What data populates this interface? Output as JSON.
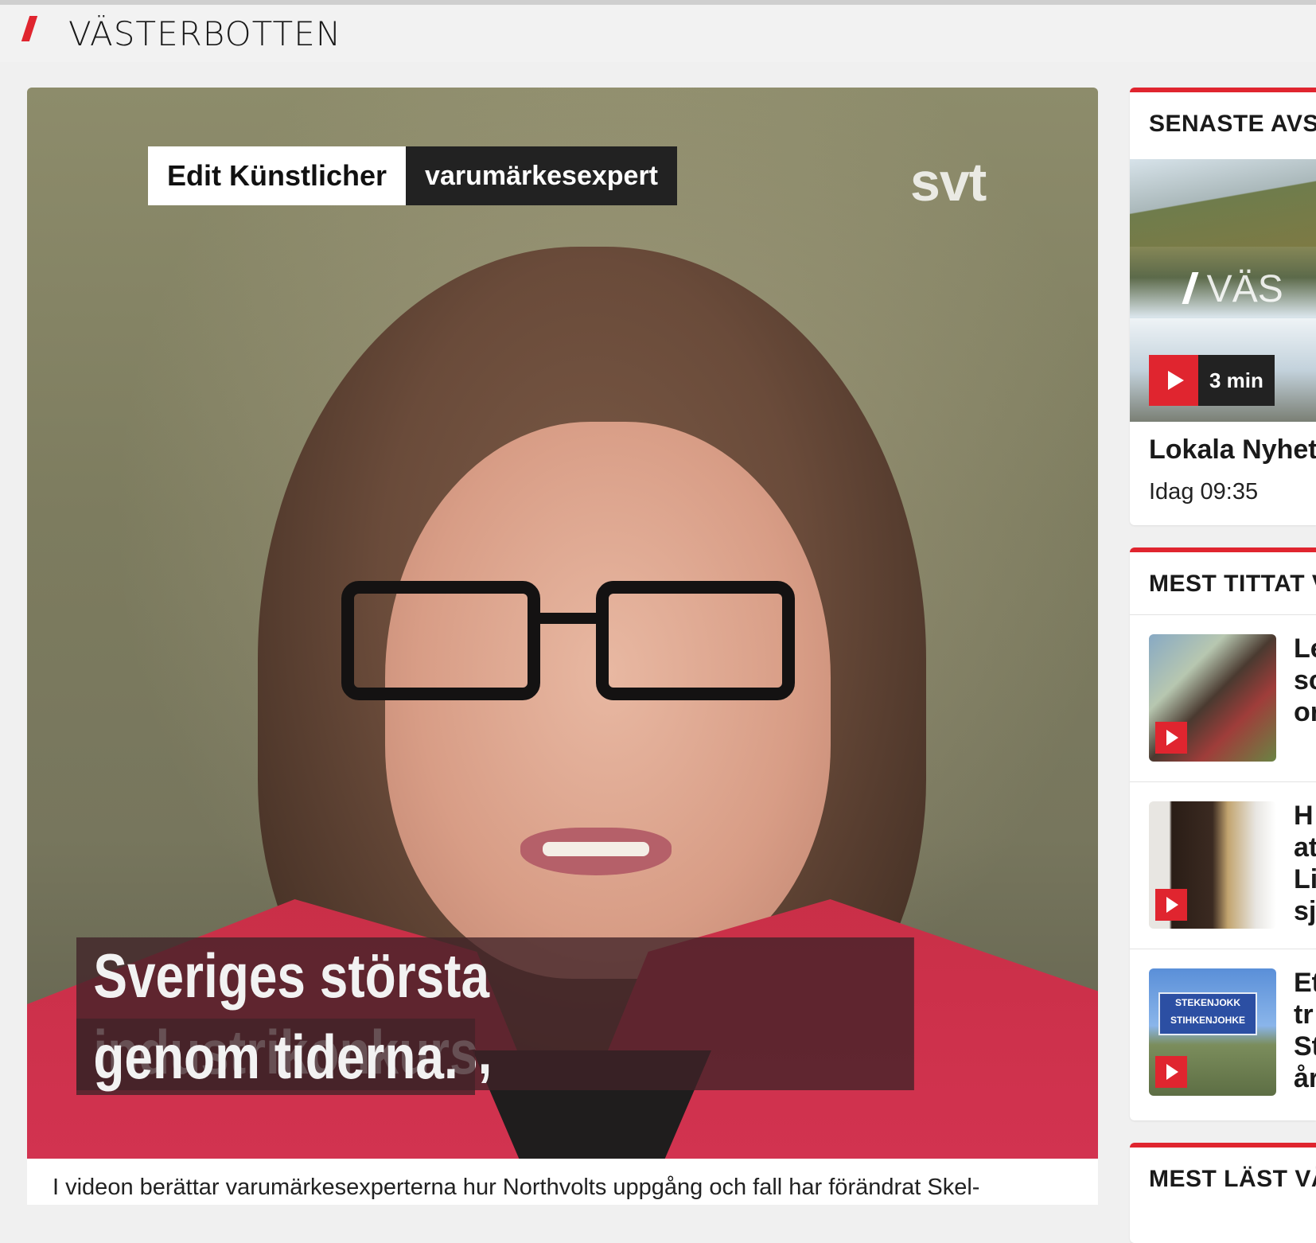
{
  "header": {
    "section_title": "VÄSTERBOTTEN"
  },
  "video": {
    "person_name": "Edit Künstlicher",
    "person_role": "varumärkesexpert",
    "brand_logo": "svt",
    "subtitle_line1": "Sveriges största industrikonkurs,",
    "subtitle_line2": "genom tiderna."
  },
  "caption": {
    "text": "I videon berättar varumärkesexperterna hur Northvolts uppgång och fall har förändrat Skel-"
  },
  "sidebar": {
    "latest": {
      "heading": "SENASTE AVS",
      "thumb_watermark": "VÄS",
      "duration": "3 min",
      "title": "Lokala Nyhet",
      "time": "Idag 09:35"
    },
    "most_watched": {
      "heading": "MEST TITTAT V",
      "items": [
        {
          "text": "Le\nsc\nor"
        },
        {
          "text": "H\nat\nLi\nsj"
        },
        {
          "text": "Et\ntr\nSt\når",
          "sign_text": "STEKENJOKK\nSTIHKENJOHKE"
        }
      ]
    },
    "most_read": {
      "heading": "MEST LÄST VÄ"
    }
  },
  "colors": {
    "accent": "#e0252f",
    "background": "#f0f0f0"
  }
}
